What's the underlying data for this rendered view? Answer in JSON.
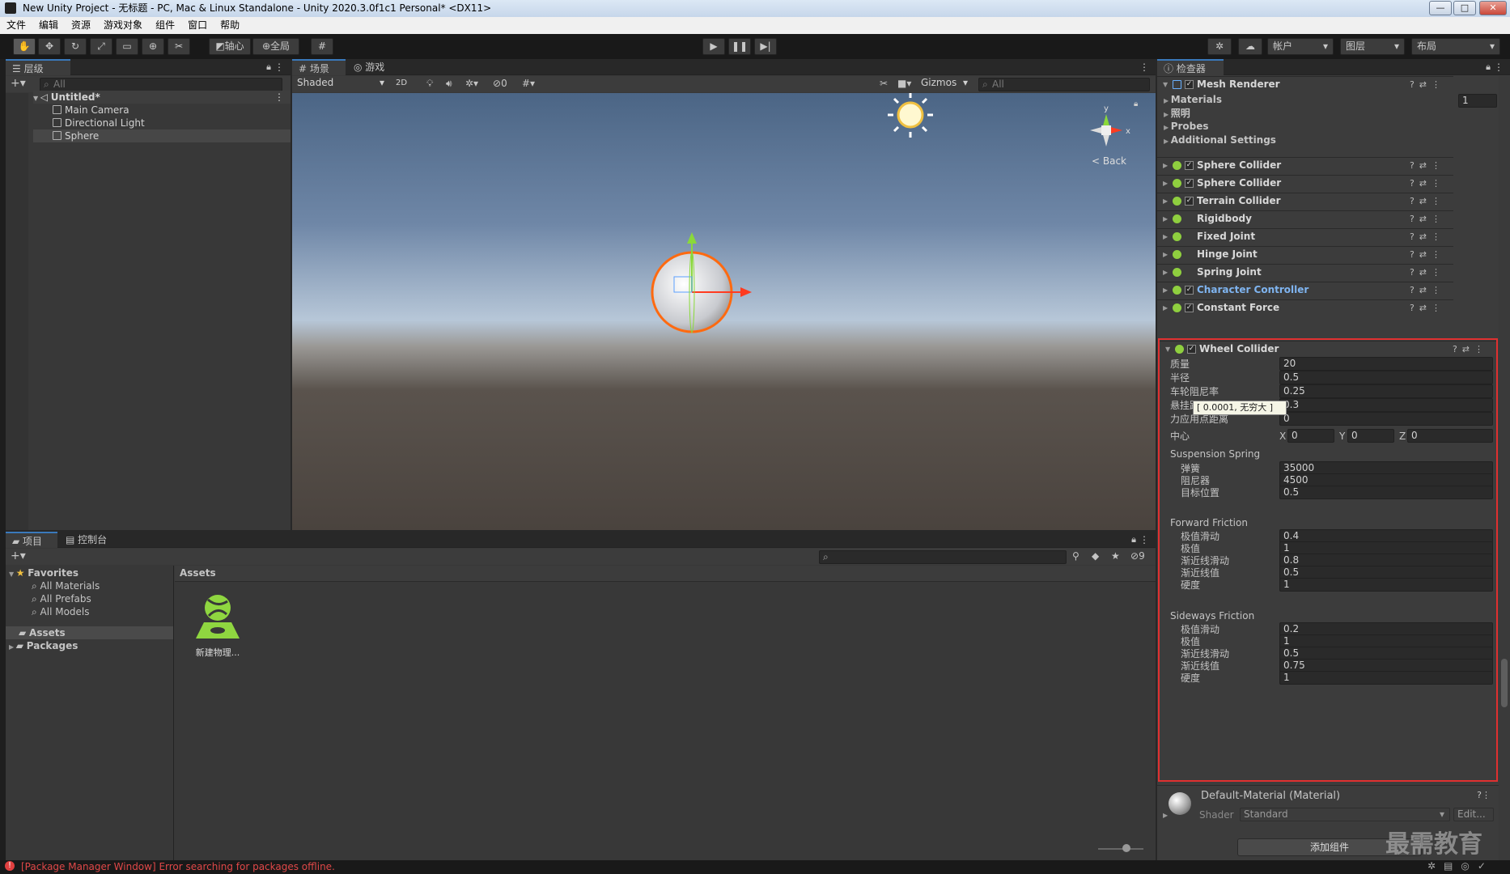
{
  "window": {
    "title": "New Unity Project - 无标题 - PC, Mac & Linux Standalone - Unity 2020.3.0f1c1 Personal* <DX11>",
    "min": "—",
    "max": "□",
    "close": "✕"
  },
  "menu": [
    "文件",
    "编辑",
    "资源",
    "游戏对象",
    "组件",
    "窗口",
    "帮助"
  ],
  "toolbar": {
    "pivot": "轴心",
    "global": "全局",
    "account": "帐户",
    "layers": "图层",
    "layout": "布局"
  },
  "hierarchy": {
    "tab": "层级",
    "search": "All",
    "scene": "Untitled*",
    "items": [
      "Main Camera",
      "Directional Light",
      "Sphere"
    ]
  },
  "scene": {
    "tab_scene": "场景",
    "tab_game": "游戏",
    "shading": "Shaded",
    "mode2d": "2D",
    "hidden_count": "0",
    "gizmos": "Gizmos",
    "search": "All",
    "back": "Back",
    "axis_x": "x",
    "axis_y": "y"
  },
  "inspector": {
    "tab": "检查器",
    "mesh_renderer": "Mesh Renderer",
    "mr_rows": [
      "Materials",
      "照明",
      "Probes",
      "Additional Settings"
    ],
    "materials_count": "1",
    "components": [
      "Sphere Collider",
      "Sphere Collider",
      "Terrain Collider",
      "Rigidbody",
      "Fixed Joint",
      "Hinge Joint",
      "Spring Joint",
      "Character Controller",
      "Constant Force"
    ],
    "wheel": {
      "title": "Wheel Collider",
      "rows": [
        {
          "label": "质量",
          "value": "20"
        },
        {
          "label": "半径",
          "value": "0.5"
        },
        {
          "label": "车轮阻尼率",
          "value": "0.25"
        },
        {
          "label": "悬挂距离",
          "value": "0.3"
        },
        {
          "label": "力应用点距离",
          "value": "0"
        }
      ],
      "tooltip": "[ 0.0001, 无穷大 ]",
      "center_label": "中心",
      "cx_label": "X",
      "cx": "0",
      "cy_label": "Y",
      "cy": "0",
      "cz_label": "Z",
      "cz": "0",
      "susp_title": "Suspension Spring",
      "susp": [
        {
          "label": "弹簧",
          "value": "35000"
        },
        {
          "label": "阻尼器",
          "value": "4500"
        },
        {
          "label": "目标位置",
          "value": "0.5"
        }
      ],
      "fwd_title": "Forward Friction",
      "fwd": [
        {
          "label": "极值滑动",
          "value": "0.4"
        },
        {
          "label": "极值",
          "value": "1"
        },
        {
          "label": "渐近线滑动",
          "value": "0.8"
        },
        {
          "label": "渐近线值",
          "value": "0.5"
        },
        {
          "label": "硬度",
          "value": "1"
        }
      ],
      "side_title": "Sideways Friction",
      "side": [
        {
          "label": "极值滑动",
          "value": "0.2"
        },
        {
          "label": "极值",
          "value": "1"
        },
        {
          "label": "渐近线滑动",
          "value": "0.5"
        },
        {
          "label": "渐近线值",
          "value": "0.75"
        },
        {
          "label": "硬度",
          "value": "1"
        }
      ]
    },
    "material": {
      "name": "Default-Material (Material)",
      "shader_label": "Shader",
      "shader": "Standard",
      "edit": "Edit..."
    },
    "add_component": "添加组件"
  },
  "project": {
    "tab_project": "项目",
    "tab_console": "控制台",
    "hidden_count": "9",
    "favorites": "Favorites",
    "fav_items": [
      "All Materials",
      "All Prefabs",
      "All Models"
    ],
    "assets": "Assets",
    "packages": "Packages",
    "assets_header": "Assets",
    "asset_name": "新建物理..."
  },
  "status": {
    "error": "[Package Manager Window] Error searching for packages offline."
  },
  "watermark": "最需教育",
  "colors": {
    "accent": "#3a79bb",
    "highlight": "#e03030",
    "component_blue": "#7fb4f0",
    "icon_green": "#8fcf3f"
  }
}
